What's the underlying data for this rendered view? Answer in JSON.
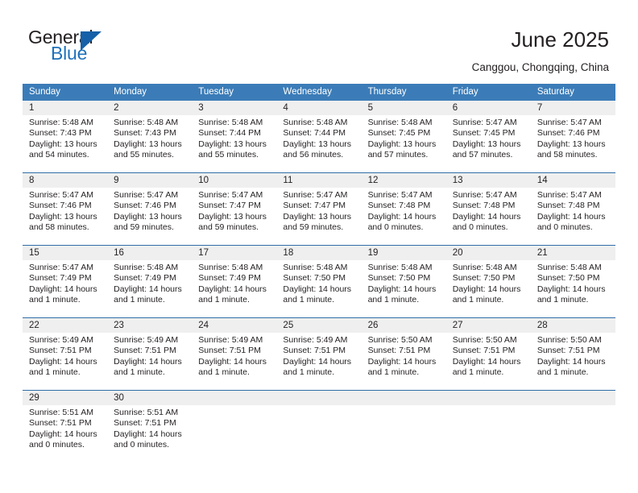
{
  "brand": {
    "name_top": "General",
    "name_bottom": "Blue",
    "accent_color": "#1e72bb",
    "triangle_color": "#1560a8"
  },
  "header": {
    "title": "June 2025",
    "subtitle": "Canggou, Chongqing, China"
  },
  "calendar": {
    "header_bg": "#3b7cb8",
    "daynum_bg": "#efefef",
    "separator_color": "#2f6ea8",
    "weekdays": [
      "Sunday",
      "Monday",
      "Tuesday",
      "Wednesday",
      "Thursday",
      "Friday",
      "Saturday"
    ],
    "weeks": [
      [
        {
          "day": "1",
          "l1": "Sunrise: 5:48 AM",
          "l2": "Sunset: 7:43 PM",
          "l3": "Daylight: 13 hours",
          "l4": "and 54 minutes."
        },
        {
          "day": "2",
          "l1": "Sunrise: 5:48 AM",
          "l2": "Sunset: 7:43 PM",
          "l3": "Daylight: 13 hours",
          "l4": "and 55 minutes."
        },
        {
          "day": "3",
          "l1": "Sunrise: 5:48 AM",
          "l2": "Sunset: 7:44 PM",
          "l3": "Daylight: 13 hours",
          "l4": "and 55 minutes."
        },
        {
          "day": "4",
          "l1": "Sunrise: 5:48 AM",
          "l2": "Sunset: 7:44 PM",
          "l3": "Daylight: 13 hours",
          "l4": "and 56 minutes."
        },
        {
          "day": "5",
          "l1": "Sunrise: 5:48 AM",
          "l2": "Sunset: 7:45 PM",
          "l3": "Daylight: 13 hours",
          "l4": "and 57 minutes."
        },
        {
          "day": "6",
          "l1": "Sunrise: 5:47 AM",
          "l2": "Sunset: 7:45 PM",
          "l3": "Daylight: 13 hours",
          "l4": "and 57 minutes."
        },
        {
          "day": "7",
          "l1": "Sunrise: 5:47 AM",
          "l2": "Sunset: 7:46 PM",
          "l3": "Daylight: 13 hours",
          "l4": "and 58 minutes."
        }
      ],
      [
        {
          "day": "8",
          "l1": "Sunrise: 5:47 AM",
          "l2": "Sunset: 7:46 PM",
          "l3": "Daylight: 13 hours",
          "l4": "and 58 minutes."
        },
        {
          "day": "9",
          "l1": "Sunrise: 5:47 AM",
          "l2": "Sunset: 7:46 PM",
          "l3": "Daylight: 13 hours",
          "l4": "and 59 minutes."
        },
        {
          "day": "10",
          "l1": "Sunrise: 5:47 AM",
          "l2": "Sunset: 7:47 PM",
          "l3": "Daylight: 13 hours",
          "l4": "and 59 minutes."
        },
        {
          "day": "11",
          "l1": "Sunrise: 5:47 AM",
          "l2": "Sunset: 7:47 PM",
          "l3": "Daylight: 13 hours",
          "l4": "and 59 minutes."
        },
        {
          "day": "12",
          "l1": "Sunrise: 5:47 AM",
          "l2": "Sunset: 7:48 PM",
          "l3": "Daylight: 14 hours",
          "l4": "and 0 minutes."
        },
        {
          "day": "13",
          "l1": "Sunrise: 5:47 AM",
          "l2": "Sunset: 7:48 PM",
          "l3": "Daylight: 14 hours",
          "l4": "and 0 minutes."
        },
        {
          "day": "14",
          "l1": "Sunrise: 5:47 AM",
          "l2": "Sunset: 7:48 PM",
          "l3": "Daylight: 14 hours",
          "l4": "and 0 minutes."
        }
      ],
      [
        {
          "day": "15",
          "l1": "Sunrise: 5:47 AM",
          "l2": "Sunset: 7:49 PM",
          "l3": "Daylight: 14 hours",
          "l4": "and 1 minute."
        },
        {
          "day": "16",
          "l1": "Sunrise: 5:48 AM",
          "l2": "Sunset: 7:49 PM",
          "l3": "Daylight: 14 hours",
          "l4": "and 1 minute."
        },
        {
          "day": "17",
          "l1": "Sunrise: 5:48 AM",
          "l2": "Sunset: 7:49 PM",
          "l3": "Daylight: 14 hours",
          "l4": "and 1 minute."
        },
        {
          "day": "18",
          "l1": "Sunrise: 5:48 AM",
          "l2": "Sunset: 7:50 PM",
          "l3": "Daylight: 14 hours",
          "l4": "and 1 minute."
        },
        {
          "day": "19",
          "l1": "Sunrise: 5:48 AM",
          "l2": "Sunset: 7:50 PM",
          "l3": "Daylight: 14 hours",
          "l4": "and 1 minute."
        },
        {
          "day": "20",
          "l1": "Sunrise: 5:48 AM",
          "l2": "Sunset: 7:50 PM",
          "l3": "Daylight: 14 hours",
          "l4": "and 1 minute."
        },
        {
          "day": "21",
          "l1": "Sunrise: 5:48 AM",
          "l2": "Sunset: 7:50 PM",
          "l3": "Daylight: 14 hours",
          "l4": "and 1 minute."
        }
      ],
      [
        {
          "day": "22",
          "l1": "Sunrise: 5:49 AM",
          "l2": "Sunset: 7:51 PM",
          "l3": "Daylight: 14 hours",
          "l4": "and 1 minute."
        },
        {
          "day": "23",
          "l1": "Sunrise: 5:49 AM",
          "l2": "Sunset: 7:51 PM",
          "l3": "Daylight: 14 hours",
          "l4": "and 1 minute."
        },
        {
          "day": "24",
          "l1": "Sunrise: 5:49 AM",
          "l2": "Sunset: 7:51 PM",
          "l3": "Daylight: 14 hours",
          "l4": "and 1 minute."
        },
        {
          "day": "25",
          "l1": "Sunrise: 5:49 AM",
          "l2": "Sunset: 7:51 PM",
          "l3": "Daylight: 14 hours",
          "l4": "and 1 minute."
        },
        {
          "day": "26",
          "l1": "Sunrise: 5:50 AM",
          "l2": "Sunset: 7:51 PM",
          "l3": "Daylight: 14 hours",
          "l4": "and 1 minute."
        },
        {
          "day": "27",
          "l1": "Sunrise: 5:50 AM",
          "l2": "Sunset: 7:51 PM",
          "l3": "Daylight: 14 hours",
          "l4": "and 1 minute."
        },
        {
          "day": "28",
          "l1": "Sunrise: 5:50 AM",
          "l2": "Sunset: 7:51 PM",
          "l3": "Daylight: 14 hours",
          "l4": "and 1 minute."
        }
      ],
      [
        {
          "day": "29",
          "l1": "Sunrise: 5:51 AM",
          "l2": "Sunset: 7:51 PM",
          "l3": "Daylight: 14 hours",
          "l4": "and 0 minutes."
        },
        {
          "day": "30",
          "l1": "Sunrise: 5:51 AM",
          "l2": "Sunset: 7:51 PM",
          "l3": "Daylight: 14 hours",
          "l4": "and 0 minutes."
        },
        {
          "day": "",
          "l1": "",
          "l2": "",
          "l3": "",
          "l4": ""
        },
        {
          "day": "",
          "l1": "",
          "l2": "",
          "l3": "",
          "l4": ""
        },
        {
          "day": "",
          "l1": "",
          "l2": "",
          "l3": "",
          "l4": ""
        },
        {
          "day": "",
          "l1": "",
          "l2": "",
          "l3": "",
          "l4": ""
        },
        {
          "day": "",
          "l1": "",
          "l2": "",
          "l3": "",
          "l4": ""
        }
      ]
    ]
  }
}
